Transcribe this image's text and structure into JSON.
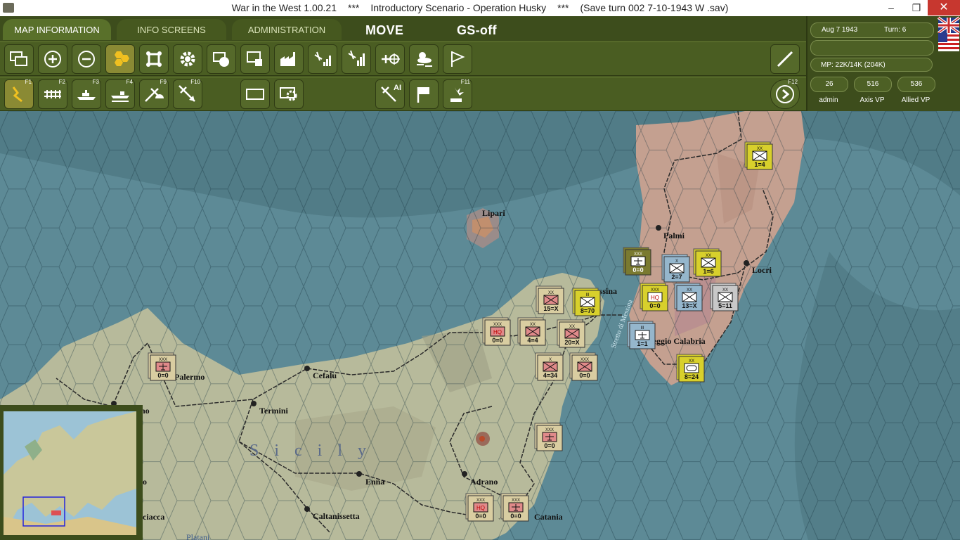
{
  "window": {
    "app_title": "War in the West 1.00.21",
    "sep1": "***",
    "scenario": "Introductory Scenario - Operation Husky",
    "sep2": "***",
    "save": "(Save turn 002 7-10-1943 W .sav)",
    "min_glyph": "–",
    "max_glyph": "❐",
    "close_glyph": "✕"
  },
  "tabs": [
    "MAP INFORMATION",
    "INFO SCREENS",
    "ADMINISTRATION"
  ],
  "mode": {
    "move": "MOVE",
    "gs": "GS-off"
  },
  "toolbar_row1_icons": [
    "windows-icon",
    "zoom-in-icon",
    "zoom-out-icon",
    "hex-grid-icon",
    "supply-icon",
    "settings-icon",
    "unit-display-icon",
    "unit-info-icon",
    "factory-icon",
    "air-recon-icon",
    "air-supply-icon",
    "air-bomb-icon",
    "weather-icon",
    "flag-icon"
  ],
  "toolbar_row2": [
    {
      "icon": "move-path-icon",
      "key": "F1"
    },
    {
      "icon": "rail-icon",
      "key": "F2"
    },
    {
      "icon": "naval-move-icon",
      "key": "F3"
    },
    {
      "icon": "naval-transport-icon",
      "key": "F4"
    },
    {
      "icon": "air-drop-icon",
      "key": "F9"
    },
    {
      "icon": "air-strike-icon",
      "key": "F10"
    },
    {
      "icon": "box-select-icon",
      "key": ""
    },
    {
      "icon": "box-settings-icon",
      "key": ""
    },
    {
      "icon": "air-ai-icon",
      "key": ""
    },
    {
      "icon": "flag-goal-icon",
      "key": ""
    },
    {
      "icon": "combat-icon",
      "key": "F11"
    }
  ],
  "end_turn_key": "F12",
  "ai_label": "AI",
  "status": {
    "date": "Aug 7 1943",
    "turn": "Turn: 6",
    "mp": "MP:  22K/14K (204K)",
    "admin_value": "26",
    "admin_label": "admin",
    "axis_vp_value": "516",
    "axis_vp_label": "Axis VP",
    "allied_vp_value": "536",
    "allied_vp_label": "Allied VP"
  },
  "colors": {
    "sea": "#5d8a96",
    "land": "#b7ba9b",
    "mainland": "#c4a090",
    "toolbar": "#3d4d1c",
    "german_counter": "#d9cda1",
    "allied_counter": "#d8d02c",
    "italian_counter": "#95b6cc"
  },
  "map": {
    "places": [
      "Lipari",
      "Palmi",
      "Locri",
      "Messina",
      "Reggio Calabria",
      "Palermo",
      "Cefalu",
      "Termini",
      "Enna",
      "Adrano",
      "Caltanissetta",
      "Catania",
      "Sicily",
      "no",
      "o",
      "ciacca",
      "Stretto di Messina",
      "Platani"
    ],
    "units": [
      {
        "echelon": "XX",
        "type": "infantry",
        "strength": "1=4",
        "side": "allied"
      },
      {
        "echelon": "XXX",
        "type": "hq-air",
        "strength": "0=0",
        "side": "allied-dark"
      },
      {
        "echelon": "X",
        "type": "infantry",
        "strength": "2=7",
        "side": "italian"
      },
      {
        "echelon": "XX",
        "type": "infantry",
        "strength": "1=6",
        "side": "allied"
      },
      {
        "echelon": "XX",
        "type": "infantry",
        "strength": "15=X",
        "side": "german"
      },
      {
        "echelon": "III",
        "type": "infantry",
        "strength": "8=70",
        "side": "allied"
      },
      {
        "echelon": "XXX",
        "type": "HQ",
        "strength": "0=0",
        "side": "allied"
      },
      {
        "echelon": "XX",
        "type": "infantry-dot",
        "strength": "13=X",
        "side": "italian"
      },
      {
        "echelon": "XX",
        "type": "infantry",
        "strength": "5=11",
        "side": "grey"
      },
      {
        "echelon": "XXX",
        "type": "HQ",
        "strength": "0=0",
        "side": "german"
      },
      {
        "echelon": "XX",
        "type": "infantry",
        "strength": "4=4",
        "side": "german"
      },
      {
        "echelon": "XX",
        "type": "infantry",
        "strength": "20=X",
        "side": "german"
      },
      {
        "echelon": "III",
        "type": "hq-air",
        "strength": "1=1",
        "side": "italian"
      },
      {
        "echelon": "X",
        "type": "infantry",
        "strength": "4=34",
        "side": "german"
      },
      {
        "echelon": "XXX",
        "type": "infantry",
        "strength": "0=0",
        "side": "german"
      },
      {
        "echelon": "XX",
        "type": "armor",
        "strength": "8=24",
        "side": "allied"
      },
      {
        "echelon": "XXX",
        "type": "hq-air",
        "strength": "0=0",
        "side": "german"
      },
      {
        "echelon": "XXX",
        "type": "hq-air",
        "strength": "0=0",
        "side": "german"
      },
      {
        "echelon": "XXX",
        "type": "HQ",
        "strength": "0=0",
        "side": "german"
      },
      {
        "echelon": "XXX",
        "type": "hq-air",
        "strength": "0=0",
        "side": "german"
      }
    ]
  }
}
